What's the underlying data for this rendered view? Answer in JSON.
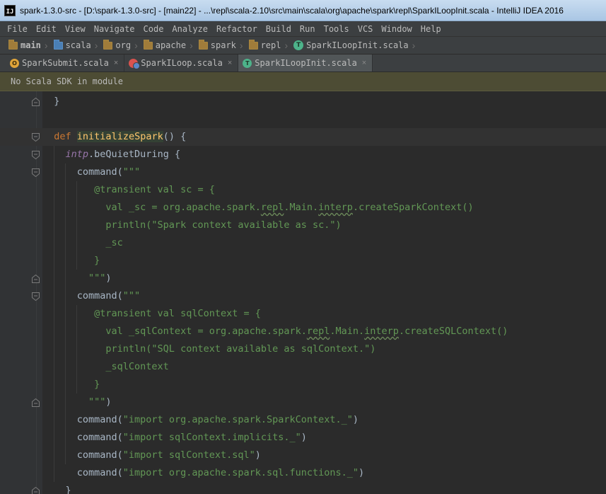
{
  "window": {
    "title": "spark-1.3.0-src - [D:\\spark-1.3.0-src] - [main22] - ...\\repl\\scala-2.10\\src\\main\\scala\\org\\apache\\spark\\repl\\SparkILoopInit.scala - IntelliJ IDEA 2016",
    "app_icon_text": "IJ"
  },
  "menu": {
    "items": [
      "File",
      "Edit",
      "View",
      "Navigate",
      "Code",
      "Analyze",
      "Refactor",
      "Build",
      "Run",
      "Tools",
      "VCS",
      "Window",
      "Help"
    ]
  },
  "breadcrumb": {
    "items": [
      {
        "label": "main",
        "icon": "module-folder-icon"
      },
      {
        "label": "scala",
        "icon": "source-folder-icon"
      },
      {
        "label": "org",
        "icon": "package-folder-icon"
      },
      {
        "label": "apache",
        "icon": "package-folder-icon"
      },
      {
        "label": "spark",
        "icon": "package-folder-icon"
      },
      {
        "label": "repl",
        "icon": "package-folder-icon"
      },
      {
        "label": "SparkILoopInit.scala",
        "icon": "trait-icon"
      }
    ]
  },
  "tabs": {
    "items": [
      {
        "label": "SparkSubmit.scala",
        "icon": "object-icon",
        "active": false
      },
      {
        "label": "SparkILoop.scala",
        "icon": "scala-class-icon",
        "active": false
      },
      {
        "label": "SparkILoopInit.scala",
        "icon": "trait-icon",
        "active": true
      }
    ],
    "close_glyph": "×"
  },
  "banner": {
    "text": "No Scala SDK in module"
  },
  "colors": {
    "background": "#2b2b2b",
    "keyword": "#cc7832",
    "function": "#ffc66d",
    "string": "#629755",
    "annotation": "#bbb529",
    "field": "#9876aa",
    "text": "#a9b7c6"
  },
  "editor": {
    "lines": [
      {
        "indent": 0,
        "fold": "end",
        "tokens": [
          {
            "t": "  }",
            "c": "plain"
          }
        ]
      },
      {
        "indent": 0,
        "fold": "",
        "tokens": []
      },
      {
        "indent": 0,
        "fold": "start",
        "current": true,
        "tokens": [
          {
            "t": "  ",
            "c": "plain"
          },
          {
            "t": "def",
            "c": "kw"
          },
          {
            "t": " ",
            "c": "plain"
          },
          {
            "t": "initializeSpark",
            "c": "fn-hl"
          },
          {
            "t": "() {",
            "c": "plain"
          }
        ]
      },
      {
        "indent": 0,
        "fold": "start",
        "tokens": [
          {
            "t": "    ",
            "c": "plain"
          },
          {
            "t": "intp",
            "c": "field"
          },
          {
            "t": ".beQuietDuring {",
            "c": "plain"
          }
        ]
      },
      {
        "indent": 0,
        "fold": "start",
        "tokens": [
          {
            "t": "      command(",
            "c": "plain"
          },
          {
            "t": "\"\"\"",
            "c": "str"
          }
        ]
      },
      {
        "indent": 0,
        "fold": "",
        "tokens": [
          {
            "t": "         @transient val sc = {",
            "c": "str"
          }
        ]
      },
      {
        "indent": 0,
        "fold": "",
        "tokens": [
          {
            "t": "           val _sc = org.apache.spark.",
            "c": "str"
          },
          {
            "t": "repl",
            "c": "str wavy"
          },
          {
            "t": ".Main.",
            "c": "str"
          },
          {
            "t": "interp",
            "c": "str wavy"
          },
          {
            "t": ".createSparkContext()",
            "c": "str"
          }
        ]
      },
      {
        "indent": 0,
        "fold": "",
        "tokens": [
          {
            "t": "           println(\"Spark context available as sc.\")",
            "c": "str"
          }
        ]
      },
      {
        "indent": 0,
        "fold": "",
        "tokens": [
          {
            "t": "           _sc",
            "c": "str"
          }
        ]
      },
      {
        "indent": 0,
        "fold": "",
        "tokens": [
          {
            "t": "         }",
            "c": "str"
          }
        ]
      },
      {
        "indent": 0,
        "fold": "end",
        "tokens": [
          {
            "t": "        \"\"\"",
            "c": "str"
          },
          {
            "t": ")",
            "c": "plain"
          }
        ]
      },
      {
        "indent": 0,
        "fold": "start",
        "tokens": [
          {
            "t": "      command(",
            "c": "plain"
          },
          {
            "t": "\"\"\"",
            "c": "str"
          }
        ]
      },
      {
        "indent": 0,
        "fold": "",
        "tokens": [
          {
            "t": "         @transient val sqlContext = {",
            "c": "str"
          }
        ]
      },
      {
        "indent": 0,
        "fold": "",
        "tokens": [
          {
            "t": "           val _sqlContext = org.apache.spark.",
            "c": "str"
          },
          {
            "t": "repl",
            "c": "str wavy"
          },
          {
            "t": ".Main.",
            "c": "str"
          },
          {
            "t": "interp",
            "c": "str wavy"
          },
          {
            "t": ".createSQLContext()",
            "c": "str"
          }
        ]
      },
      {
        "indent": 0,
        "fold": "",
        "tokens": [
          {
            "t": "           println(\"SQL context available as sqlContext.\")",
            "c": "str"
          }
        ]
      },
      {
        "indent": 0,
        "fold": "",
        "tokens": [
          {
            "t": "           _sqlContext",
            "c": "str"
          }
        ]
      },
      {
        "indent": 0,
        "fold": "",
        "tokens": [
          {
            "t": "         }",
            "c": "str"
          }
        ]
      },
      {
        "indent": 0,
        "fold": "end",
        "tokens": [
          {
            "t": "        \"\"\"",
            "c": "str"
          },
          {
            "t": ")",
            "c": "plain"
          }
        ]
      },
      {
        "indent": 0,
        "fold": "",
        "tokens": [
          {
            "t": "      command(",
            "c": "plain"
          },
          {
            "t": "\"import org.apache.spark.SparkContext._\"",
            "c": "str"
          },
          {
            "t": ")",
            "c": "plain"
          }
        ]
      },
      {
        "indent": 0,
        "fold": "",
        "tokens": [
          {
            "t": "      command(",
            "c": "plain"
          },
          {
            "t": "\"import sqlContext.implicits._\"",
            "c": "str"
          },
          {
            "t": ")",
            "c": "plain"
          }
        ]
      },
      {
        "indent": 0,
        "fold": "",
        "tokens": [
          {
            "t": "      command(",
            "c": "plain"
          },
          {
            "t": "\"import sqlContext.sql\"",
            "c": "str"
          },
          {
            "t": ")",
            "c": "plain"
          }
        ]
      },
      {
        "indent": 0,
        "fold": "",
        "tokens": [
          {
            "t": "      command(",
            "c": "plain"
          },
          {
            "t": "\"import org.apache.spark.sql.functions._\"",
            "c": "str"
          },
          {
            "t": ")",
            "c": "plain"
          }
        ]
      },
      {
        "indent": 0,
        "fold": "end",
        "tokens": [
          {
            "t": "    }",
            "c": "plain"
          }
        ]
      }
    ]
  }
}
